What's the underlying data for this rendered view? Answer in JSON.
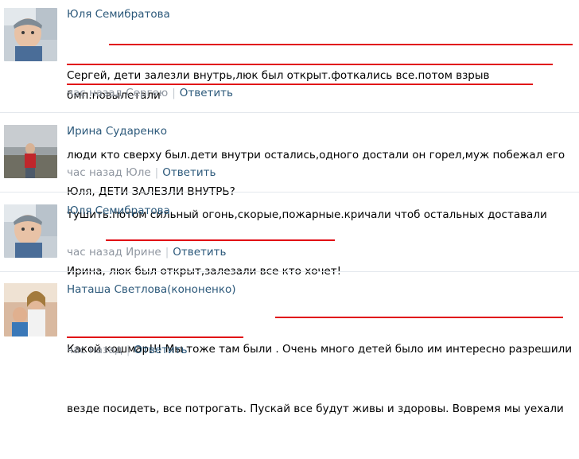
{
  "comments": [
    {
      "author": "Юля Семибратова",
      "lines": [
        "Сергей, дети залезли внутрь,люк был открыт.фоткались все.потом взрыв бмп.повылетали",
        "люди кто сверху был.дети внутри остались,одного достали он горел,муж побежал его",
        "тушить.потом сильный огонь,скорые,пожарные.кричали чтоб остальных доставали"
      ],
      "time": "час назад Сергею",
      "reply": "Ответить",
      "avatar_icon": "child-photo"
    },
    {
      "author": "Ирина Сударенко",
      "lines": [
        "Юля, ДЕТИ ЗАЛЕЗЛИ ВНУТРЬ?"
      ],
      "time": "час назад Юле",
      "reply": "Ответить",
      "avatar_icon": "woman-photo"
    },
    {
      "author": "Юля Семибратова",
      "lines": [
        "Ирина, люк был открыт,залезали все кто хочет!"
      ],
      "time": "час назад Ирине",
      "reply": "Ответить",
      "avatar_icon": "child-photo"
    },
    {
      "author": "Наташа Светлова(кононенко)",
      "lines": [
        "Какой кошмар!!! Мы тоже там были . Очень много детей было им интересно разрешили",
        "везде посидеть, все потрогать. Пускай все будут живы и здоровы. Вовремя мы уехали"
      ],
      "time": "час назад",
      "reply": "Ответить",
      "avatar_icon": "family-photo"
    }
  ],
  "colors": {
    "link": "#2b587a",
    "meta": "#8f96a0",
    "underline": "#e10a14",
    "divider": "#e4e8ed"
  }
}
